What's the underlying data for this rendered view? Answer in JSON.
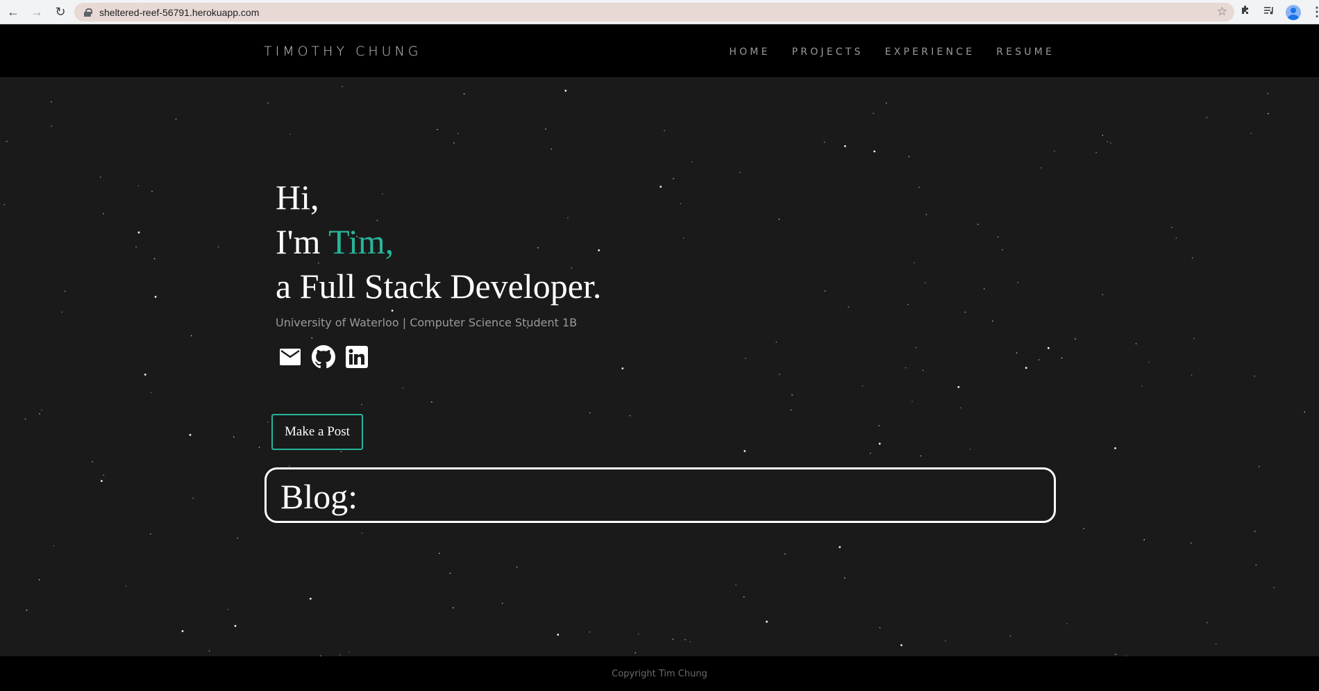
{
  "browser": {
    "back_icon": "arrow-left-icon",
    "forward_icon": "arrow-right-icon",
    "reload_icon": "reload-icon",
    "url": "sheltered-reef-56791.herokuapp.com",
    "bookmark_icon": "star-icon",
    "extensions_icon": "puzzle-icon",
    "media_icon": "playlist-icon",
    "profile_icon": "avatar-icon",
    "menu_icon": "kebab-icon"
  },
  "nav": {
    "brand": "TIMOTHY CHUNG",
    "links": [
      "HOME",
      "PROJECTS",
      "EXPERIENCE",
      "RESUME"
    ]
  },
  "hero": {
    "line1": "Hi,",
    "line2_prefix": "I'm ",
    "line2_name": "Tim,",
    "line3": "a Full Stack Developer.",
    "subtitle": "University of Waterloo | Computer Science Student 1B",
    "accent_color": "#27b59a"
  },
  "social": {
    "icons": [
      "mail-icon",
      "github-icon",
      "linkedin-icon"
    ]
  },
  "actions": {
    "make_post": "Make a Post"
  },
  "blog": {
    "heading": "Blog:"
  },
  "footer": {
    "copyright": "Copyright Tim Chung"
  }
}
